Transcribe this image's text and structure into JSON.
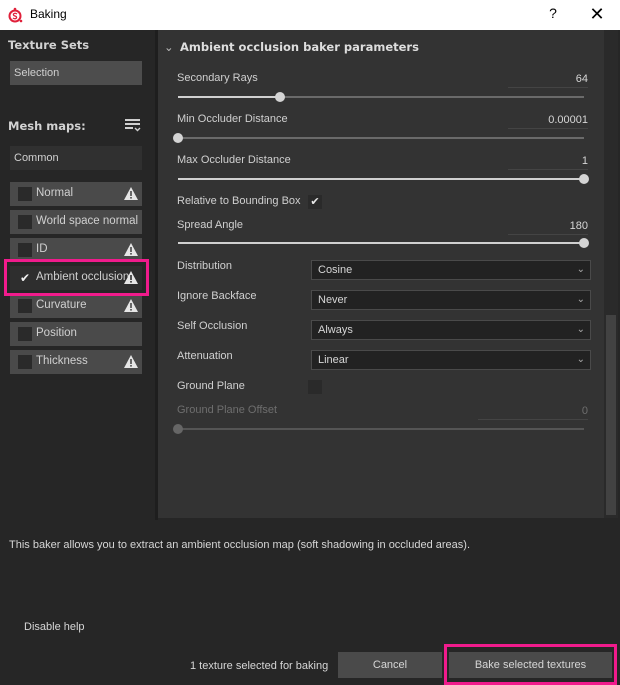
{
  "window": {
    "title": "Baking",
    "help_label": "?",
    "close_label": "✕"
  },
  "left": {
    "texture_sets_title": "Texture Sets",
    "texture_set_value": "Selection",
    "mesh_maps_title": "Mesh maps:",
    "filter_value": "Common",
    "items": [
      {
        "label": "Normal",
        "checked": false,
        "warning": true
      },
      {
        "label": "World space normal",
        "checked": false,
        "warning": false
      },
      {
        "label": "ID",
        "checked": false,
        "warning": true
      },
      {
        "label": "Ambient occlusion",
        "checked": true,
        "warning": true
      },
      {
        "label": "Curvature",
        "checked": false,
        "warning": true
      },
      {
        "label": "Position",
        "checked": false,
        "warning": false
      },
      {
        "label": "Thickness",
        "checked": false,
        "warning": true
      }
    ],
    "check_glyph": "✔"
  },
  "panel": {
    "header": "Ambient occlusion baker parameters",
    "header_chevron": "⌄",
    "secondary_rays": {
      "label": "Secondary Rays",
      "value": "64",
      "fraction": 0.25
    },
    "min_occluder": {
      "label": "Min Occluder Distance",
      "value": "0.00001",
      "fraction": 0.0
    },
    "max_occluder": {
      "label": "Max Occluder Distance",
      "value": "1",
      "fraction": 1.0
    },
    "relative_bbox": {
      "label": "Relative to Bounding Box",
      "checked": true,
      "glyph": "✔"
    },
    "spread_angle": {
      "label": "Spread Angle",
      "value": "180",
      "fraction": 1.0
    },
    "distribution": {
      "label": "Distribution",
      "value": "Cosine"
    },
    "ignore_backface": {
      "label": "Ignore Backface",
      "value": "Never"
    },
    "self_occlusion": {
      "label": "Self Occlusion",
      "value": "Always"
    },
    "attenuation": {
      "label": "Attenuation",
      "value": "Linear"
    },
    "ground_plane": {
      "label": "Ground Plane",
      "checked": false
    },
    "ground_plane_offset": {
      "label": "Ground Plane Offset",
      "value": "0",
      "fraction": 0.0,
      "disabled": true
    },
    "dropdown_arrow": "⌄"
  },
  "footer": {
    "help_text": "This baker allows you to extract an ambient occlusion map (soft shadowing in occluded areas).",
    "disable_help": "Disable help",
    "status": "1 texture selected for baking",
    "cancel": "Cancel",
    "bake": "Bake selected textures"
  },
  "colors": {
    "highlight": "#f01b8c",
    "app_icon": "#e0203a"
  }
}
